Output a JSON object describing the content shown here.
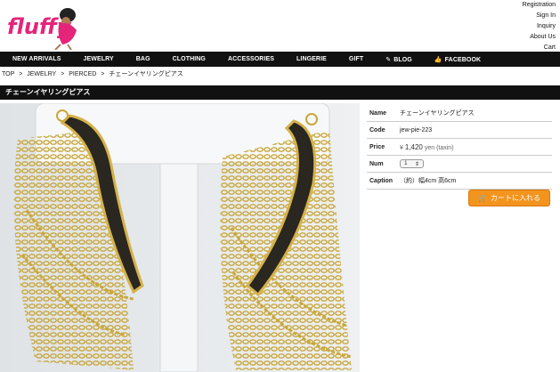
{
  "brand": {
    "logo_text": "fluffy"
  },
  "toplinks": [
    "Registration",
    "Sign In",
    "Inquiry",
    "About Us",
    "Cart"
  ],
  "nav": [
    {
      "label": "NEW ARRIVALS",
      "icon": ""
    },
    {
      "label": "JEWELRY",
      "icon": ""
    },
    {
      "label": "BAG",
      "icon": ""
    },
    {
      "label": "CLOTHING",
      "icon": ""
    },
    {
      "label": "ACCESSORIES",
      "icon": ""
    },
    {
      "label": "LINGERIE",
      "icon": ""
    },
    {
      "label": "GIFT",
      "icon": ""
    },
    {
      "label": "BLOG",
      "icon": "pencil-icon"
    },
    {
      "label": "FACEBOOK",
      "icon": "thumbs-up-icon"
    }
  ],
  "breadcrumb": [
    "TOP",
    ">",
    "JEWELRY",
    ">",
    "PIERCED",
    ">",
    "チェーンイヤリングピアス"
  ],
  "product": {
    "title": "チェーンイヤリングピアス",
    "name_label": "Name",
    "name": "チェーンイヤリングピアス",
    "code_label": "Code",
    "code": "jew-pie-223",
    "price_label": "Price",
    "price_symbol": "¥",
    "price_value": "1,420",
    "price_suffix": "yen (taxin)",
    "num_label": "Num",
    "num_value": "1",
    "caption_label": "Caption",
    "caption": "（約）幅4cm 高6cm",
    "cart_button": "カートに入れる"
  },
  "colors": {
    "nav_bg": "#111111",
    "cart": "#f3941e",
    "brand_pink": "#e4257a"
  }
}
